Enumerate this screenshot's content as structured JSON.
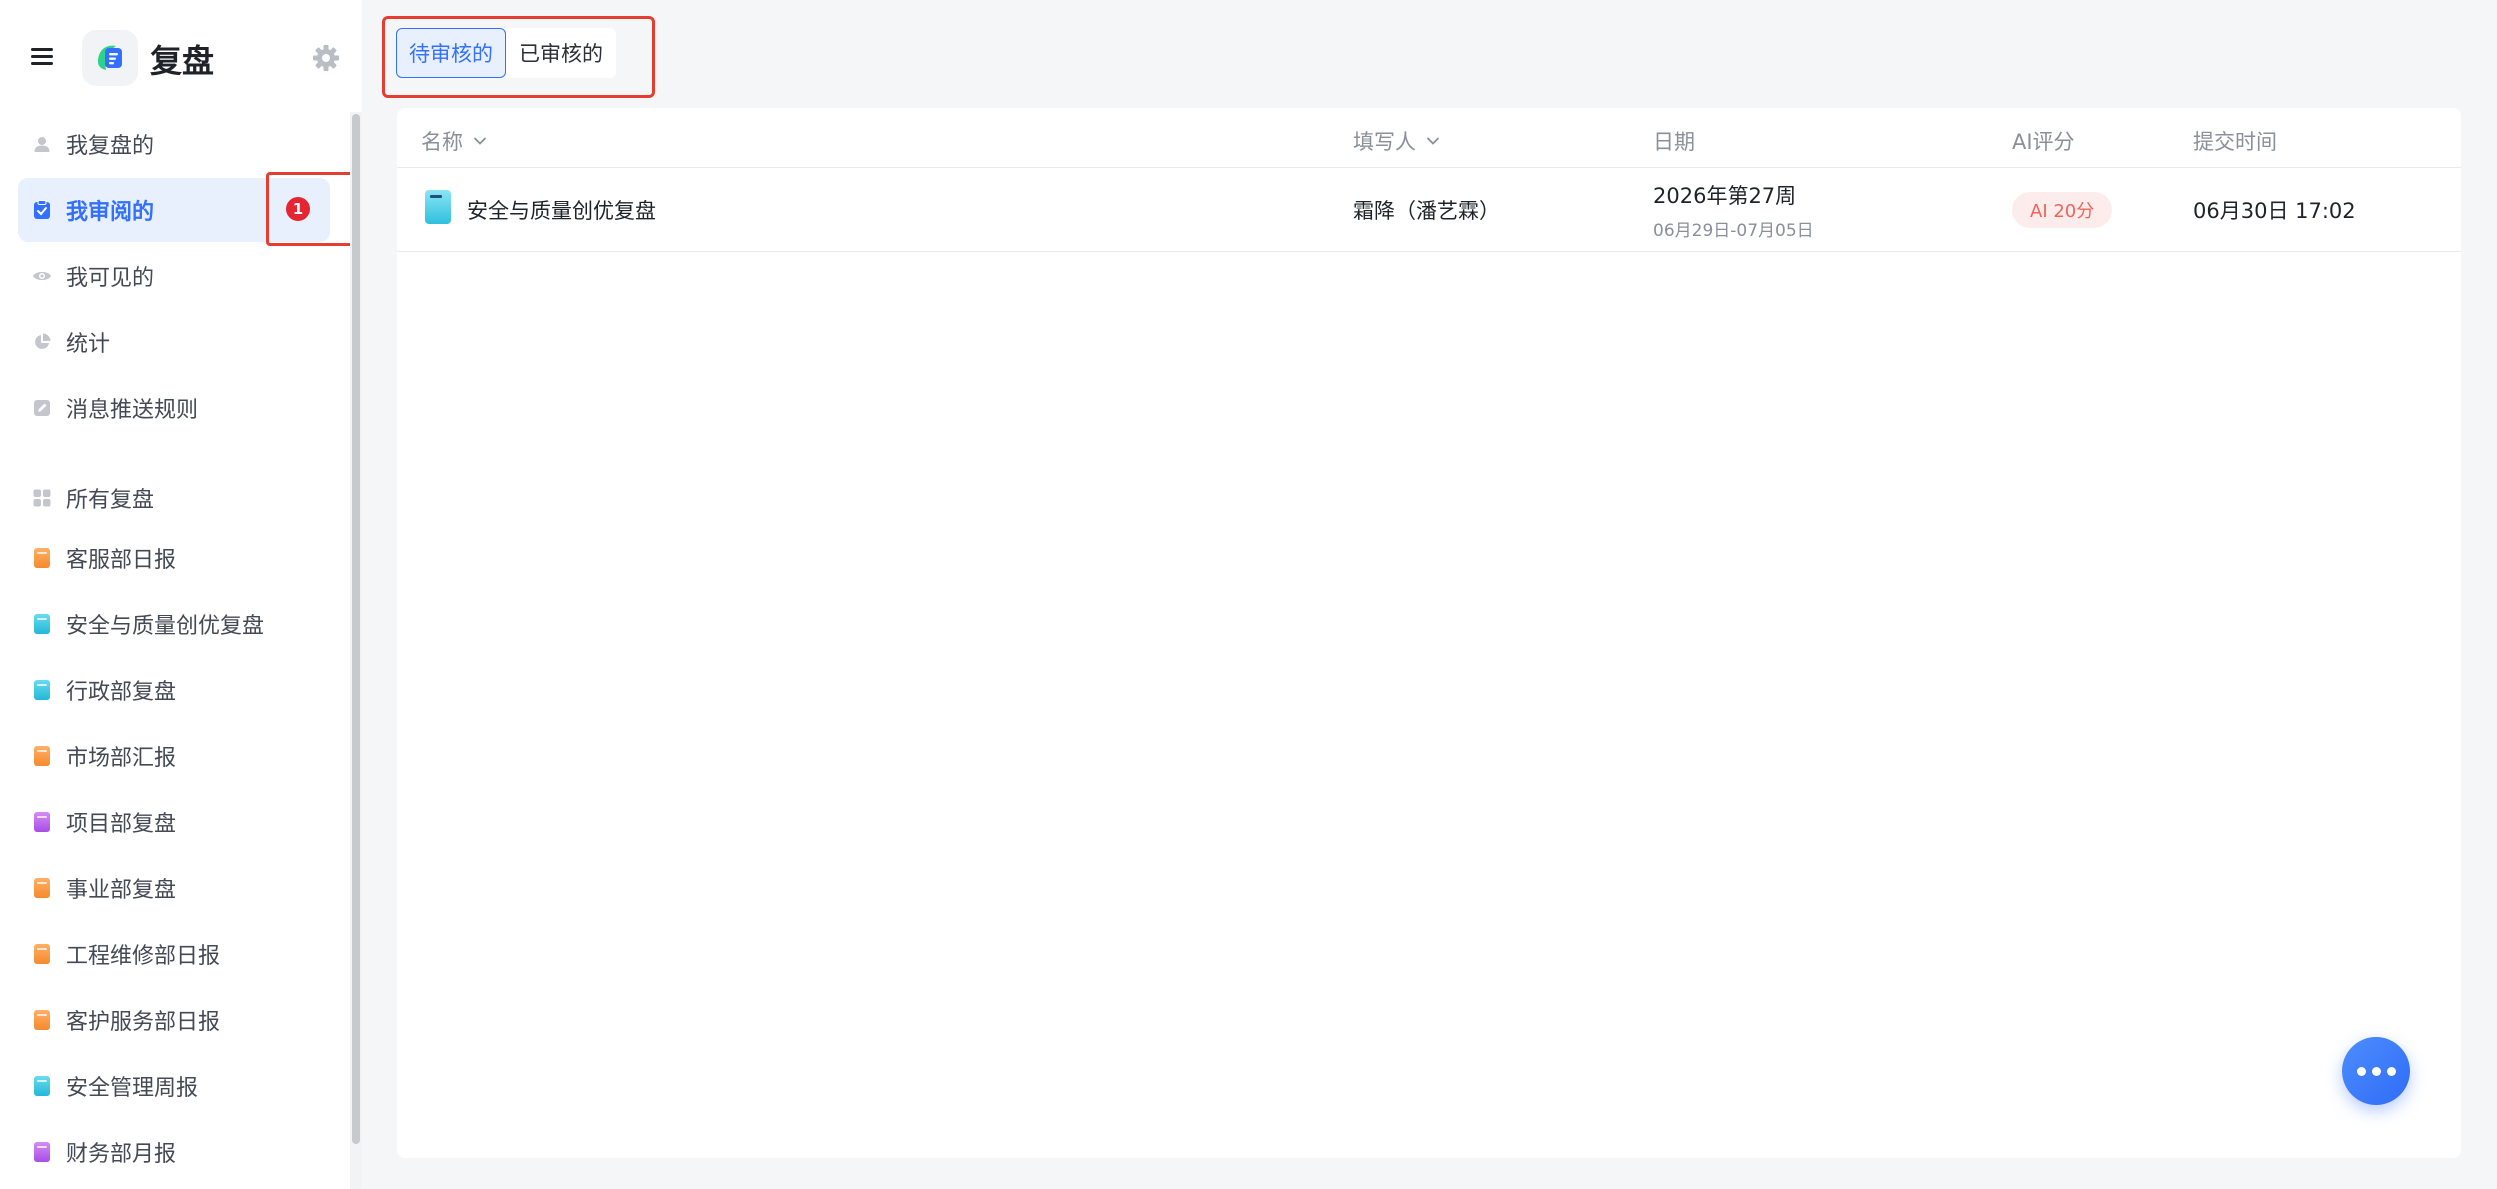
{
  "app": {
    "title": "复盘"
  },
  "sidebar": {
    "items": [
      {
        "label": "我复盘的",
        "icon": "person-icon"
      },
      {
        "label": "我审阅的",
        "icon": "review-clipboard-icon",
        "active": true,
        "badge": "1"
      },
      {
        "label": "我可见的",
        "icon": "eye-icon"
      },
      {
        "label": "统计",
        "icon": "pie-chart-icon"
      },
      {
        "label": "消息推送规则",
        "icon": "edit-icon"
      }
    ],
    "groups_label": "所有复盘",
    "groups": [
      {
        "label": "客服部日报",
        "color": "orange"
      },
      {
        "label": "安全与质量创优复盘",
        "color": "cyan"
      },
      {
        "label": "行政部复盘",
        "color": "cyan"
      },
      {
        "label": "市场部汇报",
        "color": "orange"
      },
      {
        "label": "项目部复盘",
        "color": "purple"
      },
      {
        "label": "事业部复盘",
        "color": "orange"
      },
      {
        "label": "工程维修部日报",
        "color": "orange"
      },
      {
        "label": "客护服务部日报",
        "color": "orange"
      },
      {
        "label": "安全管理周报",
        "color": "cyan"
      },
      {
        "label": "财务部月报",
        "color": "purple"
      }
    ]
  },
  "tabs": [
    {
      "label": "待审核的",
      "active": true
    },
    {
      "label": "已审核的",
      "active": false
    }
  ],
  "table": {
    "columns": {
      "name": "名称",
      "author": "填写人",
      "date": "日期",
      "ai_score": "AI评分",
      "submit_time": "提交时间"
    },
    "rows": [
      {
        "name": "安全与质量创优复盘",
        "author": "霜降（潘艺霖）",
        "date_main": "2026年第27周",
        "date_range": "06月29日-07月05日",
        "ai_score": "AI 20分",
        "submit_time": "06月30日 17:02"
      }
    ]
  },
  "colors": {
    "accent": "#3370ff",
    "highlight_border": "#e53d2f",
    "badge": "#e5252f",
    "ai_tag_text": "#f0645a",
    "ai_tag_bg": "#fdecec"
  }
}
